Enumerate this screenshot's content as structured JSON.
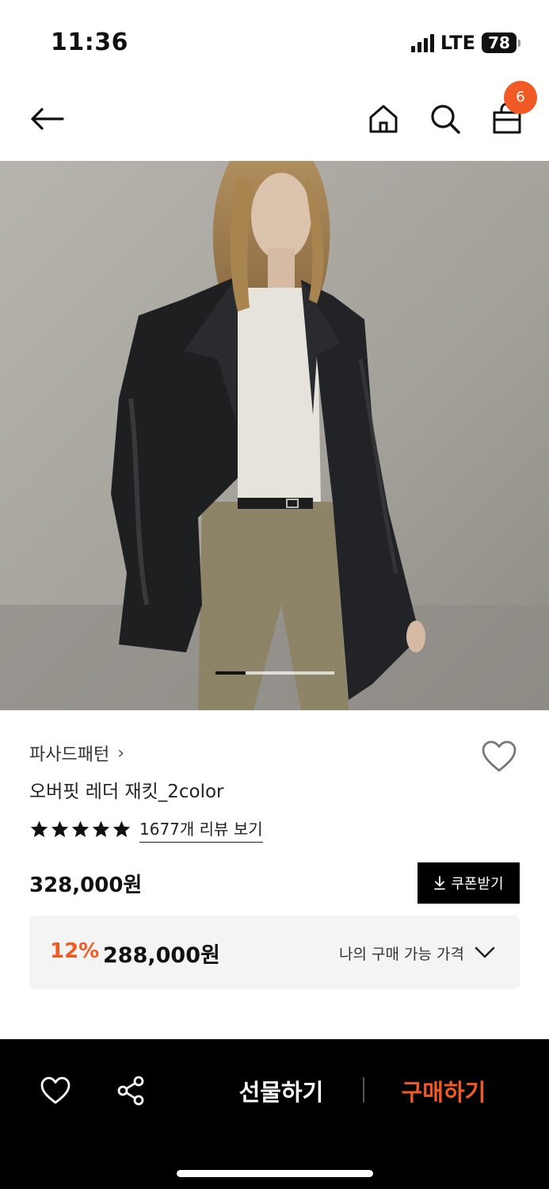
{
  "status_bar": {
    "time": "11:36",
    "network": "LTE",
    "battery": "78"
  },
  "nav": {
    "cart_count": "6",
    "icons": [
      "back-arrow-icon",
      "home-icon",
      "search-icon",
      "cart-icon"
    ]
  },
  "gallery": {
    "image_description_icon": "product-photo",
    "active_slide": 1,
    "slider_progress": 0.25
  },
  "product": {
    "brand": "파사드패턴",
    "brand_chevron": "›",
    "name": "오버핏 레더 재킷_2color",
    "rating_stars": 5,
    "review_link": "1677개 리뷰 보기",
    "original_price": "328,000원",
    "coupon_button": "쿠폰받기",
    "discount_rate": "12%",
    "sale_price": "288,000원",
    "my_price_label": "나의 구매 가능 가격"
  },
  "bottom_bar": {
    "gift_label": "선물하기",
    "buy_label": "구매하기"
  },
  "colors": {
    "accent": "#f15a24",
    "dark": "#000000",
    "price_box_bg": "#f4f4f4"
  }
}
